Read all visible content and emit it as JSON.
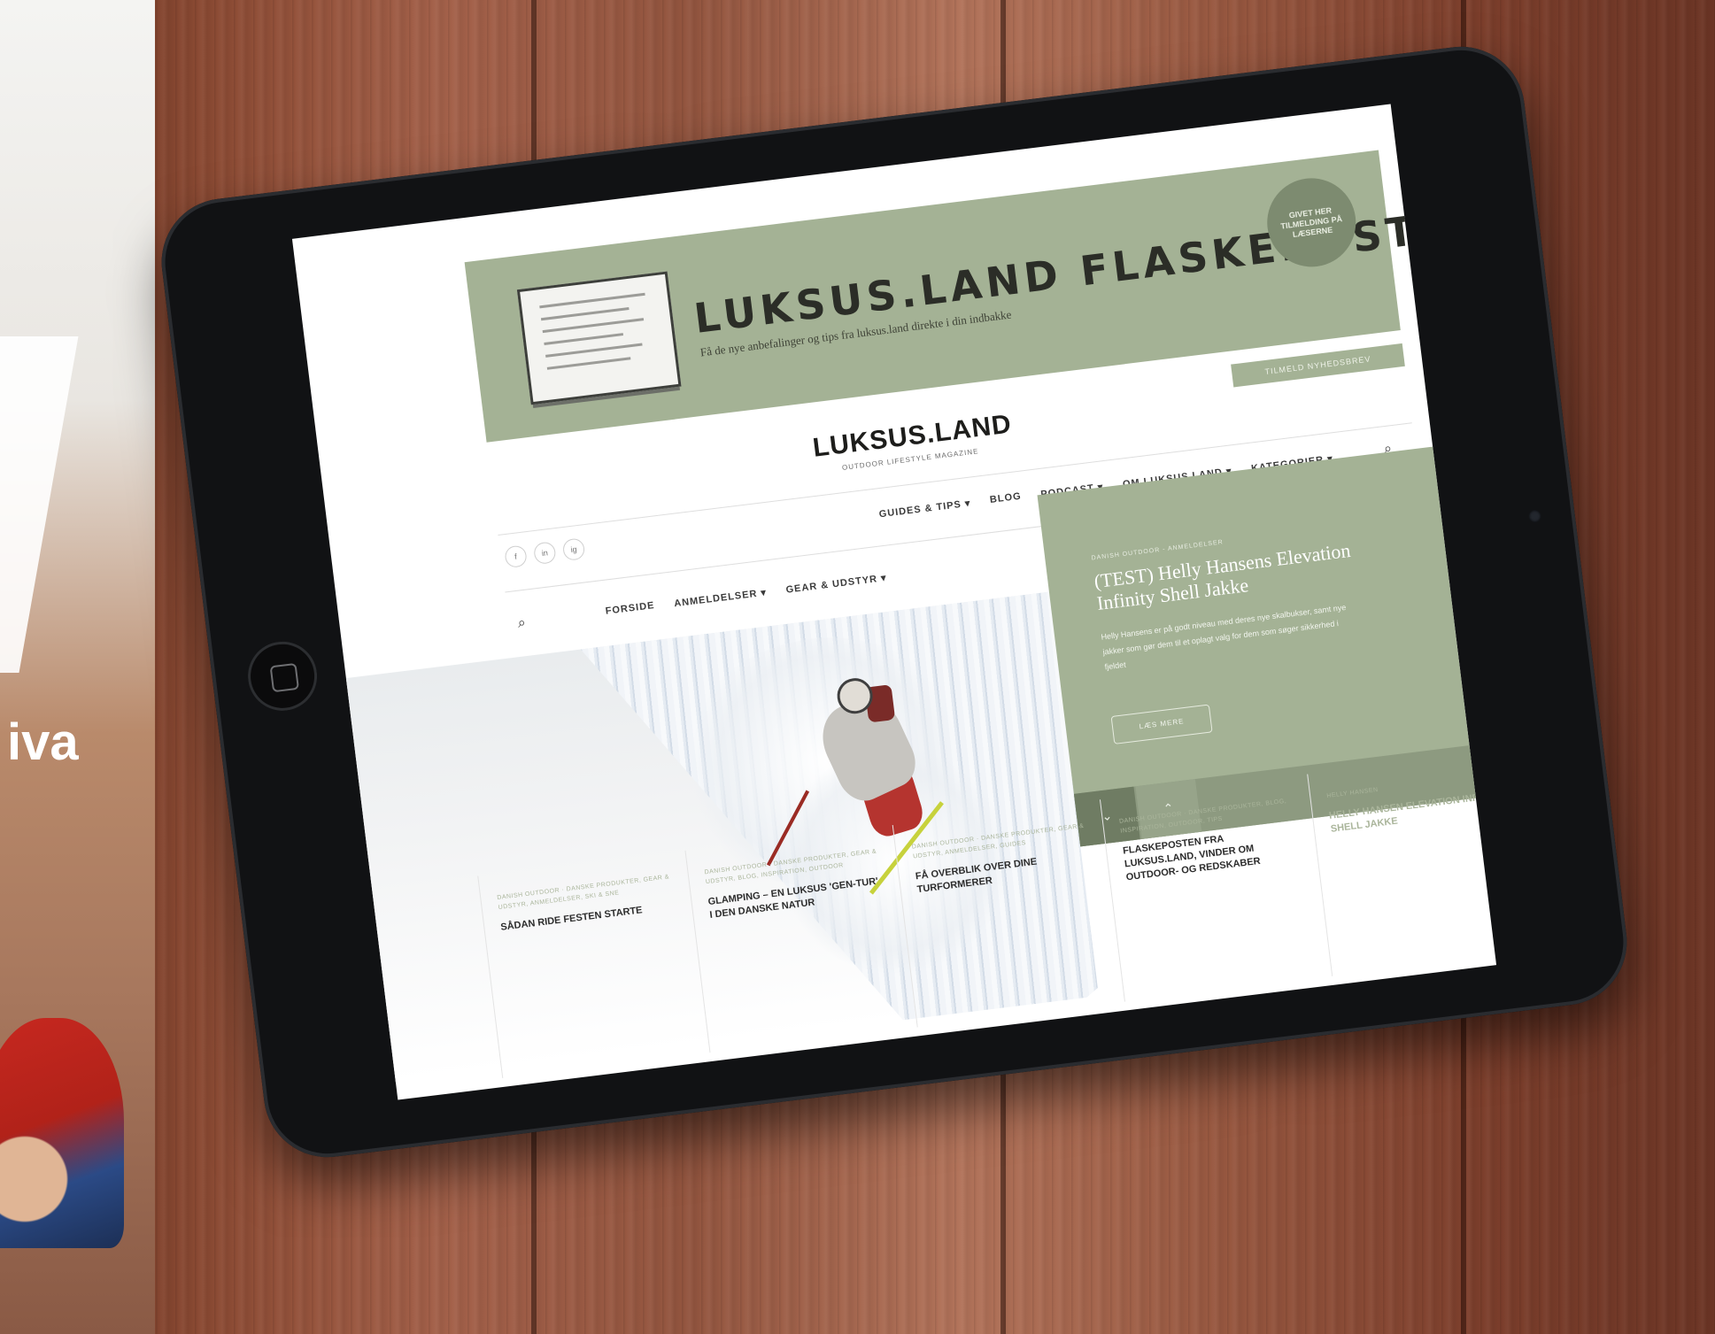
{
  "background": {
    "wood_color": "#9a5a42",
    "magazine_text": "iva"
  },
  "banner": {
    "title": "LUKSUS.LAND FLASKEPOST",
    "subtitle": "Få de nye anbefalinger og tips fra luksus.land direkte i din indbakke",
    "badge": "GIVET HER TILMELDING PÅ LÆSERNE",
    "cta": "TILMELD NYHEDSBREV",
    "color": "#a4b295"
  },
  "site": {
    "logo": "LUKSUS.LAND",
    "tagline": "OUTDOOR LIFESTYLE MAGAZINE"
  },
  "social_icons": [
    "f",
    "in",
    "ig"
  ],
  "nav_primary": [
    "GUIDES & TIPS ▾",
    "BLOG",
    "PODCAST ▾",
    "OM LUKSUS.LAND ▾",
    "KATEGORIER ▾"
  ],
  "nav_secondary": [
    "FORSIDE",
    "ANMELDELSER ▾",
    "GEAR & UDSTYR ▾"
  ],
  "feature": {
    "meta": "DANISH OUTDOOR - ANMELDELSER",
    "title": "(TEST) Helly Hansens Elevation Infinity Shell Jakke",
    "excerpt": "Helly Hansens er på godt niveau med deres nye skalbukser, samt nye jakker som gør dem til et oplagt valg for dem som søger sikkerhed i fjeldet",
    "button": "LÆS MERE",
    "down_arrow": "⌄",
    "up_arrow": "⌃"
  },
  "cards": [
    {
      "meta": "DANISH OUTDOOR · DANSKE PRODUKTER, GEAR & UDSTYR, ANMELDELSER, SKI & SNE",
      "title": "SÅDAN RIDE FESTEN STARTE"
    },
    {
      "meta": "DANISH OUTDOOR · DANSKE PRODUKTER, GEAR & UDSTYR, BLOG, INSPIRATION, OUTDOOR",
      "title": "GLAMPING – EN LUKSUS 'GEN-TUR' I DEN DANSKE NATUR"
    },
    {
      "meta": "DANISH OUTDOOR · DANSKE PRODUKTER, GEAR & UDSTYR, ANMELDELSER, GUIDES",
      "title": "FÅ OVERBLIK OVER DINE TURFORMERER"
    },
    {
      "meta": "DANISH OUTDOOR · DANSKE PRODUKTER, BLOG, INSPIRATION, OUTDOOR, TIPS",
      "title": "FLASKEPOSTEN FRA LUKSUS.LAND, VINDER OM OUTDOOR- OG REDSKABER"
    },
    {
      "meta": "HELLY HANSEN",
      "title": "HELLY HANSEN ELEVATION INFINITY SHELL JAKKE"
    }
  ]
}
